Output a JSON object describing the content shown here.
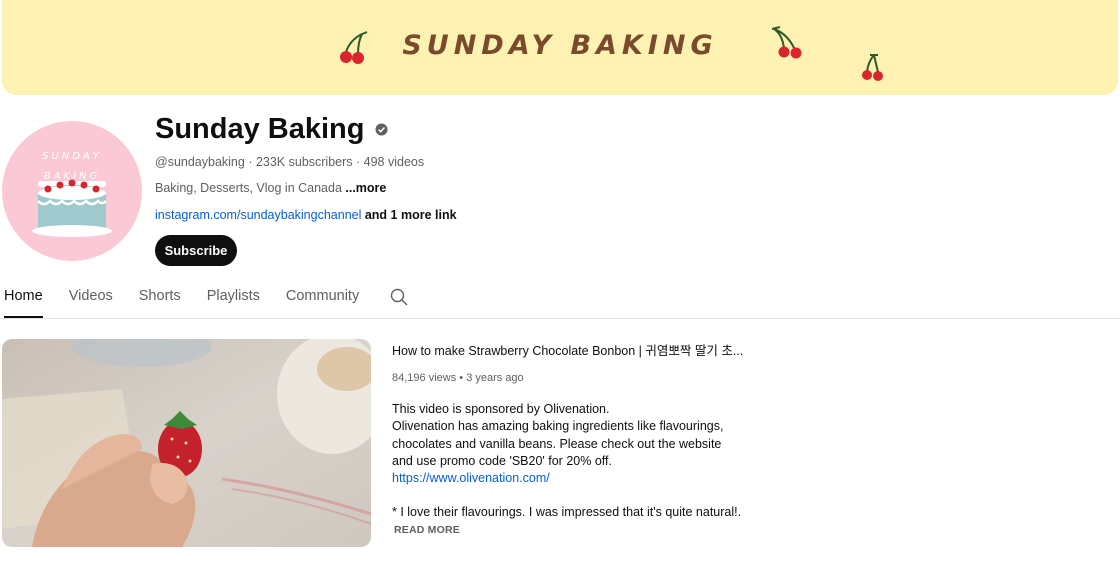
{
  "banner": {
    "title": "SUNDAY BAKING",
    "background": "#fdf2b2",
    "text_color": "#7a4a2c"
  },
  "channel": {
    "avatar_text": "SUNDAY BAKING",
    "avatar_background": "#fbc8d6",
    "name": "Sunday Baking",
    "handle": "@sundaybaking",
    "subscribers": "233K subscribers",
    "videos": "498 videos",
    "separator": " · ",
    "description": "Baking, Desserts, Vlog in Canada ",
    "more_label": "...more",
    "link_text": "instagram.com/sundaybakingchannel",
    "extra_links": " and 1 more link",
    "subscribe_label": "Subscribe"
  },
  "tabs": [
    {
      "label": "Home",
      "active": true
    },
    {
      "label": "Videos",
      "active": false
    },
    {
      "label": "Shorts",
      "active": false
    },
    {
      "label": "Playlists",
      "active": false
    },
    {
      "label": "Community",
      "active": false
    }
  ],
  "search_icon": "search-icon",
  "featured_video": {
    "title": "How to make Strawberry Chocolate Bonbon | 귀염뽀짝 딸기 초...",
    "views": "84,196 views",
    "age": "3 years ago",
    "stats_separator": " • ",
    "description": [
      "This video is sponsored by Olivenation.",
      "Olivenation has amazing baking ingredients like flavourings, chocolates and vanilla beans. Please check out the website and use promo code 'SB20' for 20% off."
    ],
    "link": "https://www.olivenation.com/",
    "last_line": "* I love their flavourings. I was impressed that it's quite natural!...",
    "read_more": "READ MORE"
  },
  "colors": {
    "text_primary": "#0f0f0f",
    "text_secondary": "#606060",
    "link": "#065fd4"
  }
}
